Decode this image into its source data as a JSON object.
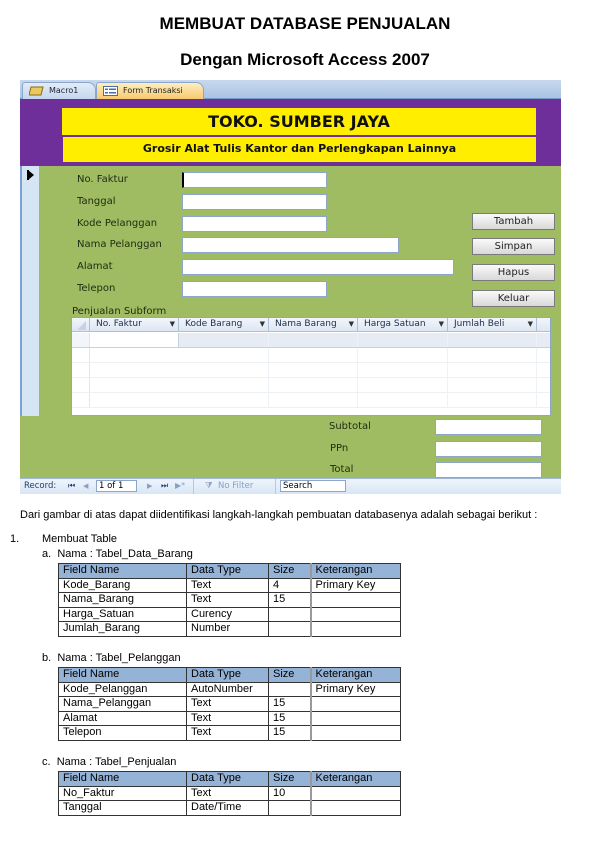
{
  "document": {
    "title": "MEMBUAT DATABASE PENJUALAN",
    "subtitle": "Dengan Microsoft Access 2007",
    "intro": "Dari gambar di atas dapat diidentifikasi langkah-langkah pembuatan databasenya adalah sebagai berikut :",
    "step_number": "1.",
    "step_title": "Membuat Table"
  },
  "access_form": {
    "tabs": [
      {
        "label": "Macro1",
        "icon": "macro-icon",
        "active": false
      },
      {
        "label": "Form Transaksi",
        "icon": "form-icon",
        "active": true
      }
    ],
    "header_title": "TOKO. SUMBER JAYA",
    "header_subtitle": "Grosir Alat Tulis Kantor dan Perlengkapan Lainnya",
    "fields": [
      {
        "label": "No. Faktur",
        "value": ""
      },
      {
        "label": "Tanggal",
        "value": ""
      },
      {
        "label": "Kode Pelanggan",
        "value": ""
      },
      {
        "label": "Nama Pelanggan",
        "value": ""
      },
      {
        "label": "Alamat",
        "value": ""
      },
      {
        "label": "Telepon",
        "value": ""
      }
    ],
    "buttons": [
      "Tambah",
      "Simpan",
      "Hapus",
      "Keluar"
    ],
    "subform": {
      "label": "Penjualan Subform",
      "columns": [
        "No. Faktur",
        "Kode Barang",
        "Nama Barang",
        "Harga Satuan",
        "Jumlah Beli"
      ]
    },
    "totals": [
      {
        "label": "Subtotal",
        "value": ""
      },
      {
        "label": "PPn",
        "value": ""
      },
      {
        "label": "Total",
        "value": ""
      }
    ],
    "record_nav": {
      "label": "Record:",
      "position": "1 of 1",
      "filter": "No Filter",
      "search_placeholder": "Search"
    },
    "colors": {
      "form_background": "#9fbc63",
      "header_band": "#6e2f9a",
      "header_yellow": "#ffee00"
    }
  },
  "tables": [
    {
      "letter": "a.",
      "title": "Nama : Tabel_Data_Barang",
      "headers": [
        "Field Name",
        "Data Type",
        "Size",
        "Keterangan"
      ],
      "rows": [
        [
          "Kode_Barang",
          "Text",
          "4",
          "Primary Key"
        ],
        [
          "Nama_Barang",
          "Text",
          "15",
          ""
        ],
        [
          "Harga_Satuan",
          "Curency",
          "",
          ""
        ],
        [
          "Jumlah_Barang",
          "Number",
          "",
          ""
        ]
      ]
    },
    {
      "letter": "b.",
      "title": "Nama : Tabel_Pelanggan",
      "headers": [
        "Field Name",
        "Data Type",
        "Size",
        "Keterangan"
      ],
      "rows": [
        [
          "Kode_Pelanggan",
          "AutoNumber",
          "",
          "Primary Key"
        ],
        [
          "Nama_Pelanggan",
          "Text",
          "15",
          ""
        ],
        [
          "Alamat",
          "Text",
          "15",
          ""
        ],
        [
          "Telepon",
          "Text",
          "15",
          ""
        ]
      ]
    },
    {
      "letter": "c.",
      "title": "Nama : Tabel_Penjualan",
      "headers": [
        "Field Name",
        "Data Type",
        "Size",
        "Keterangan"
      ],
      "rows": [
        [
          "No_Faktur",
          "Text",
          "10",
          ""
        ],
        [
          "Tanggal",
          "Date/Time",
          "",
          ""
        ]
      ],
      "header_color": "#95b3d7"
    }
  ]
}
